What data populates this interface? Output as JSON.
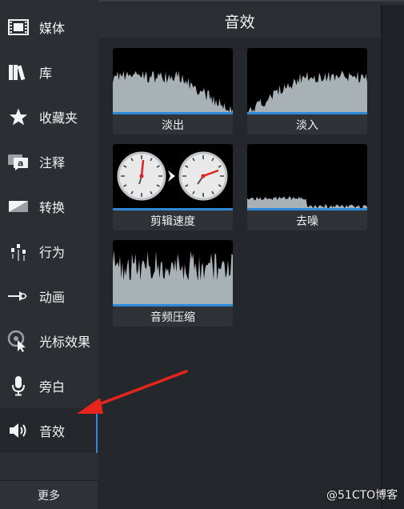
{
  "sidebar": {
    "items": [
      {
        "label": "媒体",
        "icon": "film-icon"
      },
      {
        "label": "库",
        "icon": "library-books-icon"
      },
      {
        "label": "收藏夹",
        "icon": "star-icon"
      },
      {
        "label": "注释",
        "icon": "annotation-callout-icon"
      },
      {
        "label": "转换",
        "icon": "transition-icon"
      },
      {
        "label": "行为",
        "icon": "behavior-icon"
      },
      {
        "label": "动画",
        "icon": "animation-arrow-icon"
      },
      {
        "label": "光标效果",
        "icon": "cursor-effect-icon"
      },
      {
        "label": "旁白",
        "icon": "microphone-icon"
      },
      {
        "label": "音效",
        "icon": "speaker-icon",
        "active": true
      }
    ],
    "more_label": "更多"
  },
  "panel": {
    "title": "音效",
    "tiles": [
      {
        "caption": "淡出",
        "icon": "fade-out-waveform-icon"
      },
      {
        "caption": "淡入",
        "icon": "fade-in-waveform-icon"
      },
      {
        "caption": "剪辑速度",
        "icon": "clip-speed-clocks-icon"
      },
      {
        "caption": "去噪",
        "icon": "noise-removal-waveform-icon"
      },
      {
        "caption": "音频压缩",
        "icon": "audio-compression-waveform-icon"
      }
    ]
  },
  "watermark": "@51CTO博客",
  "colors": {
    "accent": "#2f8bd9",
    "annotation_arrow": "#e8251c"
  }
}
